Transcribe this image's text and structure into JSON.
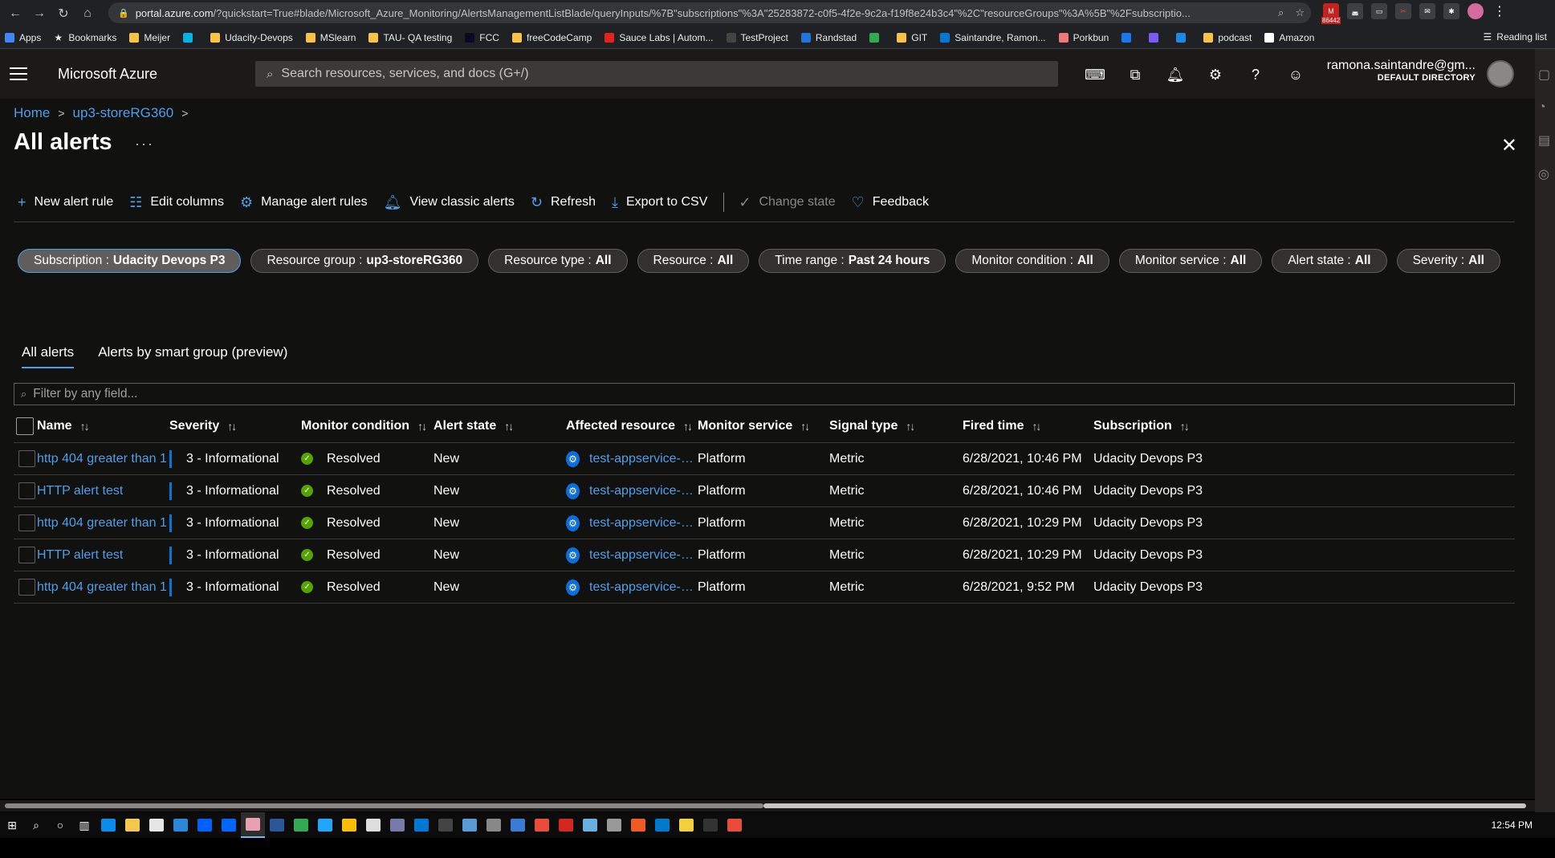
{
  "browser": {
    "url_host": "portal.azure.com",
    "url_rest": "/?quickstart=True#blade/Microsoft_Azure_Monitoring/AlertsManagementListBlade/queryInputs/%7B\"subscriptions\"%3A\"25283872-c0f5-4f2e-9c2a-f19f8e24b3c4\"%2C\"resourceGroups\"%3A%5B\"%2Fsubscriptio...",
    "badge_count": "86442",
    "bookmarks": [
      {
        "label": "Apps",
        "icon": "apps-grid-icon"
      },
      {
        "label": "Bookmarks",
        "icon": "star-icon"
      },
      {
        "label": "Meijer",
        "icon": "folder-icon"
      },
      {
        "label": "",
        "icon": "udacity-icon"
      },
      {
        "label": "Udacity-Devops",
        "icon": "folder-icon"
      },
      {
        "label": "MSlearn",
        "icon": "folder-icon"
      },
      {
        "label": "TAU- QA testing",
        "icon": "folder-icon"
      },
      {
        "label": "FCC",
        "icon": "fcc-icon"
      },
      {
        "label": "freeCodeCamp",
        "icon": "folder-icon"
      },
      {
        "label": "Sauce Labs | Autom...",
        "icon": "saucelabs-icon"
      },
      {
        "label": "TestProject",
        "icon": "testproject-icon"
      },
      {
        "label": "Randstad",
        "icon": "randstad-icon"
      },
      {
        "label": "",
        "icon": "chrome-icon"
      },
      {
        "label": "GIT",
        "icon": "folder-icon"
      },
      {
        "label": "Saintandre, Ramon...",
        "icon": "outlook-icon"
      },
      {
        "label": "Porkbun",
        "icon": "porkbun-icon"
      },
      {
        "label": "",
        "icon": "facebook-icon"
      },
      {
        "label": "",
        "icon": "linkedin-icon"
      },
      {
        "label": "",
        "icon": "grid-icon"
      },
      {
        "label": "podcast",
        "icon": "folder-icon"
      },
      {
        "label": "Amazon",
        "icon": "amazon-icon"
      }
    ],
    "reading_list": "Reading list"
  },
  "azure": {
    "brand": "Microsoft Azure",
    "search_placeholder": "Search resources, services, and docs (G+/)",
    "account_email": "ramona.saintandre@gm...",
    "account_directory": "DEFAULT DIRECTORY"
  },
  "breadcrumb": [
    {
      "label": "Home"
    },
    {
      "label": "up3-storeRG360"
    }
  ],
  "page": {
    "title": "All alerts",
    "more": "···"
  },
  "commands": [
    {
      "label": "New alert rule",
      "icon": "plus-icon"
    },
    {
      "label": "Edit columns",
      "icon": "columns-icon"
    },
    {
      "label": "Manage alert rules",
      "icon": "gear-icon"
    },
    {
      "label": "View classic alerts",
      "icon": "bell-icon"
    },
    {
      "label": "Refresh",
      "icon": "refresh-icon"
    },
    {
      "label": "Export to CSV",
      "icon": "download-icon"
    },
    {
      "label": "Change state",
      "icon": "check-icon",
      "disabled": true
    },
    {
      "label": "Feedback",
      "icon": "heart-icon"
    }
  ],
  "filters": [
    {
      "label": "Subscription :",
      "value": "Udacity Devops P3"
    },
    {
      "label": "Resource group :",
      "value": "up3-storeRG360"
    },
    {
      "label": "Resource type :",
      "value": "All"
    },
    {
      "label": "Resource :",
      "value": "All"
    },
    {
      "label": "Time range :",
      "value": "Past 24 hours"
    },
    {
      "label": "Monitor condition :",
      "value": "All"
    },
    {
      "label": "Monitor service :",
      "value": "All"
    },
    {
      "label": "Alert state :",
      "value": "All"
    },
    {
      "label": "Severity :",
      "value": "All"
    }
  ],
  "tabs": [
    {
      "label": "All alerts"
    },
    {
      "label": "Alerts by smart group (preview)"
    }
  ],
  "filter_placeholder": "Filter by any field...",
  "columns": [
    "Name",
    "Severity",
    "Monitor condition",
    "Alert state",
    "Affected resource",
    "Monitor service",
    "Signal type",
    "Fired time",
    "Subscription"
  ],
  "rows": [
    {
      "name": "http 404 greater than 1",
      "severity": "3 - Informational",
      "condition": "Resolved",
      "state": "New",
      "resource": "test-appservice-uda...",
      "service": "Platform",
      "signal": "Metric",
      "fired": "6/28/2021, 10:46 PM",
      "subscription": "Udacity Devops P3"
    },
    {
      "name": "HTTP alert test",
      "severity": "3 - Informational",
      "condition": "Resolved",
      "state": "New",
      "resource": "test-appservice-uda...",
      "service": "Platform",
      "signal": "Metric",
      "fired": "6/28/2021, 10:46 PM",
      "subscription": "Udacity Devops P3"
    },
    {
      "name": "http 404 greater than 1",
      "severity": "3 - Informational",
      "condition": "Resolved",
      "state": "New",
      "resource": "test-appservice-uda...",
      "service": "Platform",
      "signal": "Metric",
      "fired": "6/28/2021, 10:29 PM",
      "subscription": "Udacity Devops P3"
    },
    {
      "name": "HTTP alert test",
      "severity": "3 - Informational",
      "condition": "Resolved",
      "state": "New",
      "resource": "test-appservice-uda...",
      "service": "Platform",
      "signal": "Metric",
      "fired": "6/28/2021, 10:29 PM",
      "subscription": "Udacity Devops P3"
    },
    {
      "name": "http 404 greater than 1",
      "severity": "3 - Informational",
      "condition": "Resolved",
      "state": "New",
      "resource": "test-appservice-uda...",
      "service": "Platform",
      "signal": "Metric",
      "fired": "6/28/2021, 9:52 PM",
      "subscription": "Udacity Devops P3"
    }
  ],
  "taskbar": {
    "time": "12:54 PM"
  },
  "colors": {
    "accent": "#4f9eea",
    "resolved": "#57a300",
    "severity_bar": "#0078d4"
  }
}
